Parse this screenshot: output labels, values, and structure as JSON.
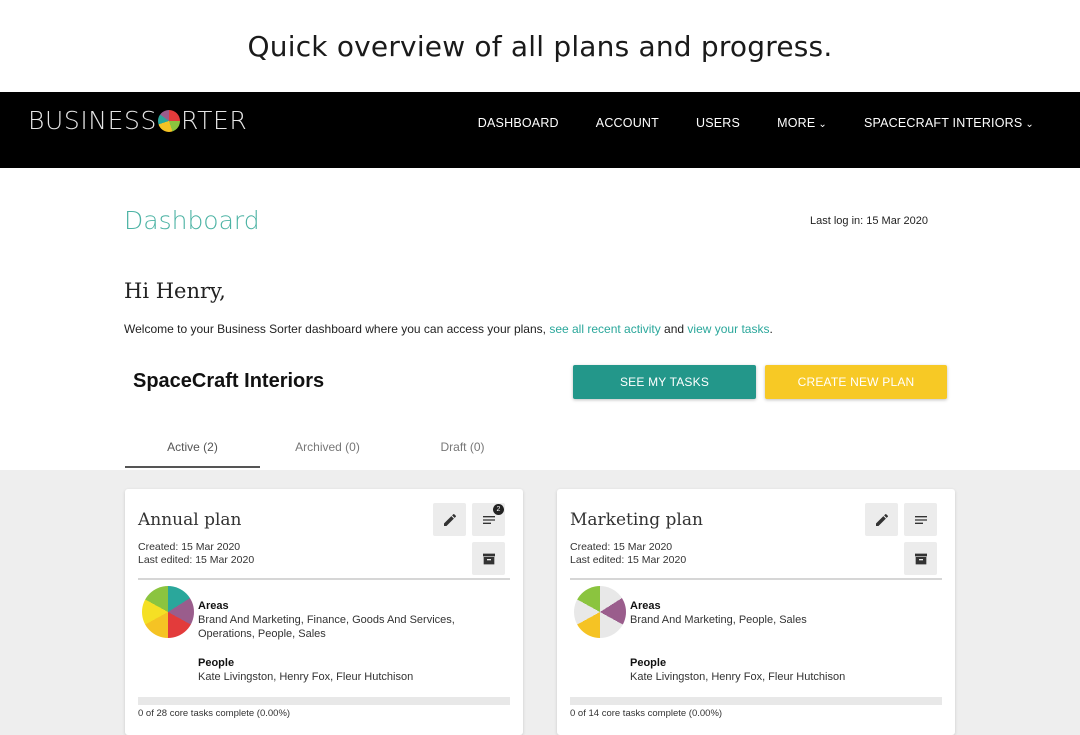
{
  "caption": "Quick overview of all plans and progress.",
  "brand": {
    "logo_left": "BUSINESS",
    "logo_mid": "S",
    "logo_right": "RTER"
  },
  "nav": {
    "dashboard": "DASHBOARD",
    "account": "ACCOUNT",
    "users": "USERS",
    "more": "MORE",
    "org": "SPACECRAFT INTERIORS"
  },
  "page": {
    "title": "Dashboard",
    "last_login": "Last log in: 15 Mar 2020",
    "greeting": "Hi Henry,",
    "welcome_prefix": "Welcome to your Business Sorter dashboard where you can access your plans, ",
    "welcome_link1": "see all recent activity",
    "welcome_mid": " and ",
    "welcome_link2": "view your tasks",
    "welcome_suffix": ".",
    "org_name": "SpaceCraft Interiors",
    "btn_tasks": "SEE MY TASKS",
    "btn_new_plan": "CREATE NEW PLAN"
  },
  "tabs": [
    "Active (2)",
    "Archived (0)",
    "Draft (0)"
  ],
  "plans": [
    {
      "title": "Annual plan",
      "created": "Created: 15 Mar 2020",
      "edited": "Last edited: 15 Mar 2020",
      "notification_count": "2",
      "areas_label": "Areas",
      "areas": "Brand And Marketing, Finance, Goods And Services, Operations, People, Sales",
      "people_label": "People",
      "people": "Kate Livingston, Henry Fox, Fleur Hutchison",
      "progress_fraction": 0,
      "progress_text": "0 of 28 core tasks complete (0.00%)"
    },
    {
      "title": "Marketing plan",
      "created": "Created: 15 Mar 2020",
      "edited": "Last edited: 15 Mar 2020",
      "areas_label": "Areas",
      "areas": "Brand And Marketing, People, Sales",
      "people_label": "People",
      "people": "Kate Livingston, Henry Fox, Fleur Hutchison",
      "progress_fraction": 0,
      "progress_text": "0 of 14 core tasks complete (0.00%)"
    }
  ],
  "colors": {
    "accent": "#2aa79b",
    "title_teal": "#4cb3a4",
    "create_yellow": "#f7c925",
    "navbar": "#000000"
  },
  "icons": [
    "pencil-icon",
    "list-icon",
    "archive-icon",
    "chevron-down-icon"
  ]
}
